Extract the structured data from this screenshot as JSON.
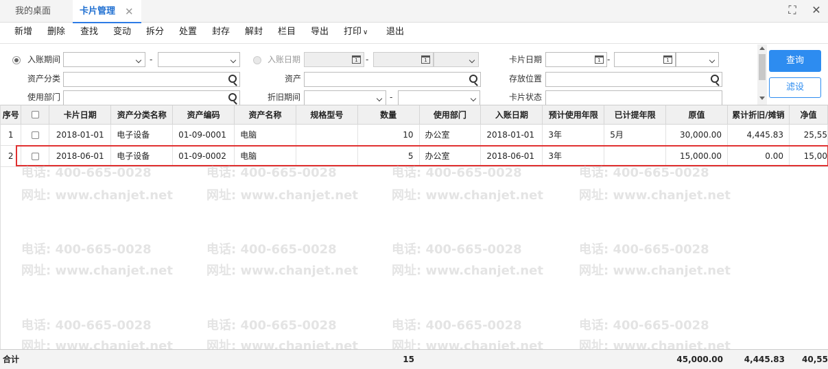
{
  "tabs": [
    {
      "label": "我的桌面"
    },
    {
      "label": "卡片管理"
    }
  ],
  "tab_close": "✕",
  "window": {
    "fullscreen_glyph": "⛶",
    "close_glyph": "✕"
  },
  "toolbar": {
    "items": [
      "新增",
      "删除",
      "查找",
      "变动",
      "拆分",
      "处置",
      "封存",
      "解封",
      "栏目",
      "导出",
      "打印",
      "退出"
    ],
    "print_caret": "∨"
  },
  "filters": {
    "row1": {
      "radio1_label": "入账期间",
      "dash": "-",
      "radio2_label": "入账日期",
      "card_date_label": "卡片日期",
      "cal_glyph": "1"
    },
    "row2": {
      "asset_class_label": "资产分类",
      "asset_label": "资产",
      "location_label": "存放位置"
    },
    "row3": {
      "dept_label": "使用部门",
      "period_label": "折旧期间",
      "status_label": "卡片状态"
    }
  },
  "buttons": {
    "query": "查询",
    "filter": "滤设"
  },
  "table": {
    "headers": [
      "序号",
      "",
      "卡片日期",
      "资产分类名称",
      "资产编码",
      "资产名称",
      "规格型号",
      "数量",
      "使用部门",
      "入账日期",
      "预计使用年限",
      "已计提年限",
      "原值",
      "累计折旧/摊销",
      "净值"
    ],
    "rows": [
      {
        "no": "1",
        "card_date": "2018-01-01",
        "class": "电子设备",
        "code": "01-09-0001",
        "name": "电脑",
        "spec": "",
        "qty": "10",
        "dept": "办公室",
        "entry_date": "2018-01-01",
        "life": "3年",
        "provided": "5月",
        "orig": "30,000.00",
        "dep": "4,445.83",
        "net": "25,55"
      },
      {
        "no": "2",
        "card_date": "2018-06-01",
        "class": "电子设备",
        "code": "01-09-0002",
        "name": "电脑",
        "spec": "",
        "qty": "5",
        "dept": "办公室",
        "entry_date": "2018-06-01",
        "life": "3年",
        "provided": "",
        "orig": "15,000.00",
        "dep": "0.00",
        "net": "15,00"
      }
    ]
  },
  "totals": {
    "label": "合计",
    "qty": "15",
    "orig": "45,000.00",
    "dep": "4,445.83",
    "net": "40,55"
  },
  "watermark": {
    "phone": "电话: 400-665-0028",
    "site": "网址: www.chanjet.net"
  }
}
